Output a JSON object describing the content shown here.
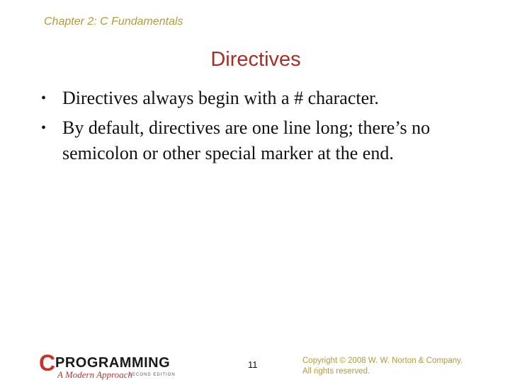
{
  "header": {
    "chapter": "Chapter 2: C Fundamentals"
  },
  "slide": {
    "title": "Directives",
    "bullets": [
      {
        "marker": "•",
        "text": "Directives always begin with a # character."
      },
      {
        "marker": "•",
        "text": "By default, directives are one line long; there’s no semicolon or other special marker at the end."
      }
    ]
  },
  "footer": {
    "logo": {
      "letter": "C",
      "word": "PROGRAMMING",
      "subtitle": "A Modern Approach",
      "edition": "SECOND EDITION"
    },
    "page_number": "11",
    "copyright_line1": "Copyright © 2008 W. W. Norton & Company.",
    "copyright_line2": "All rights reserved."
  },
  "colors": {
    "chapter": "#b29a3e",
    "title": "#a33029",
    "logo_red": "#c6322c",
    "copyright": "#b29a3e"
  }
}
